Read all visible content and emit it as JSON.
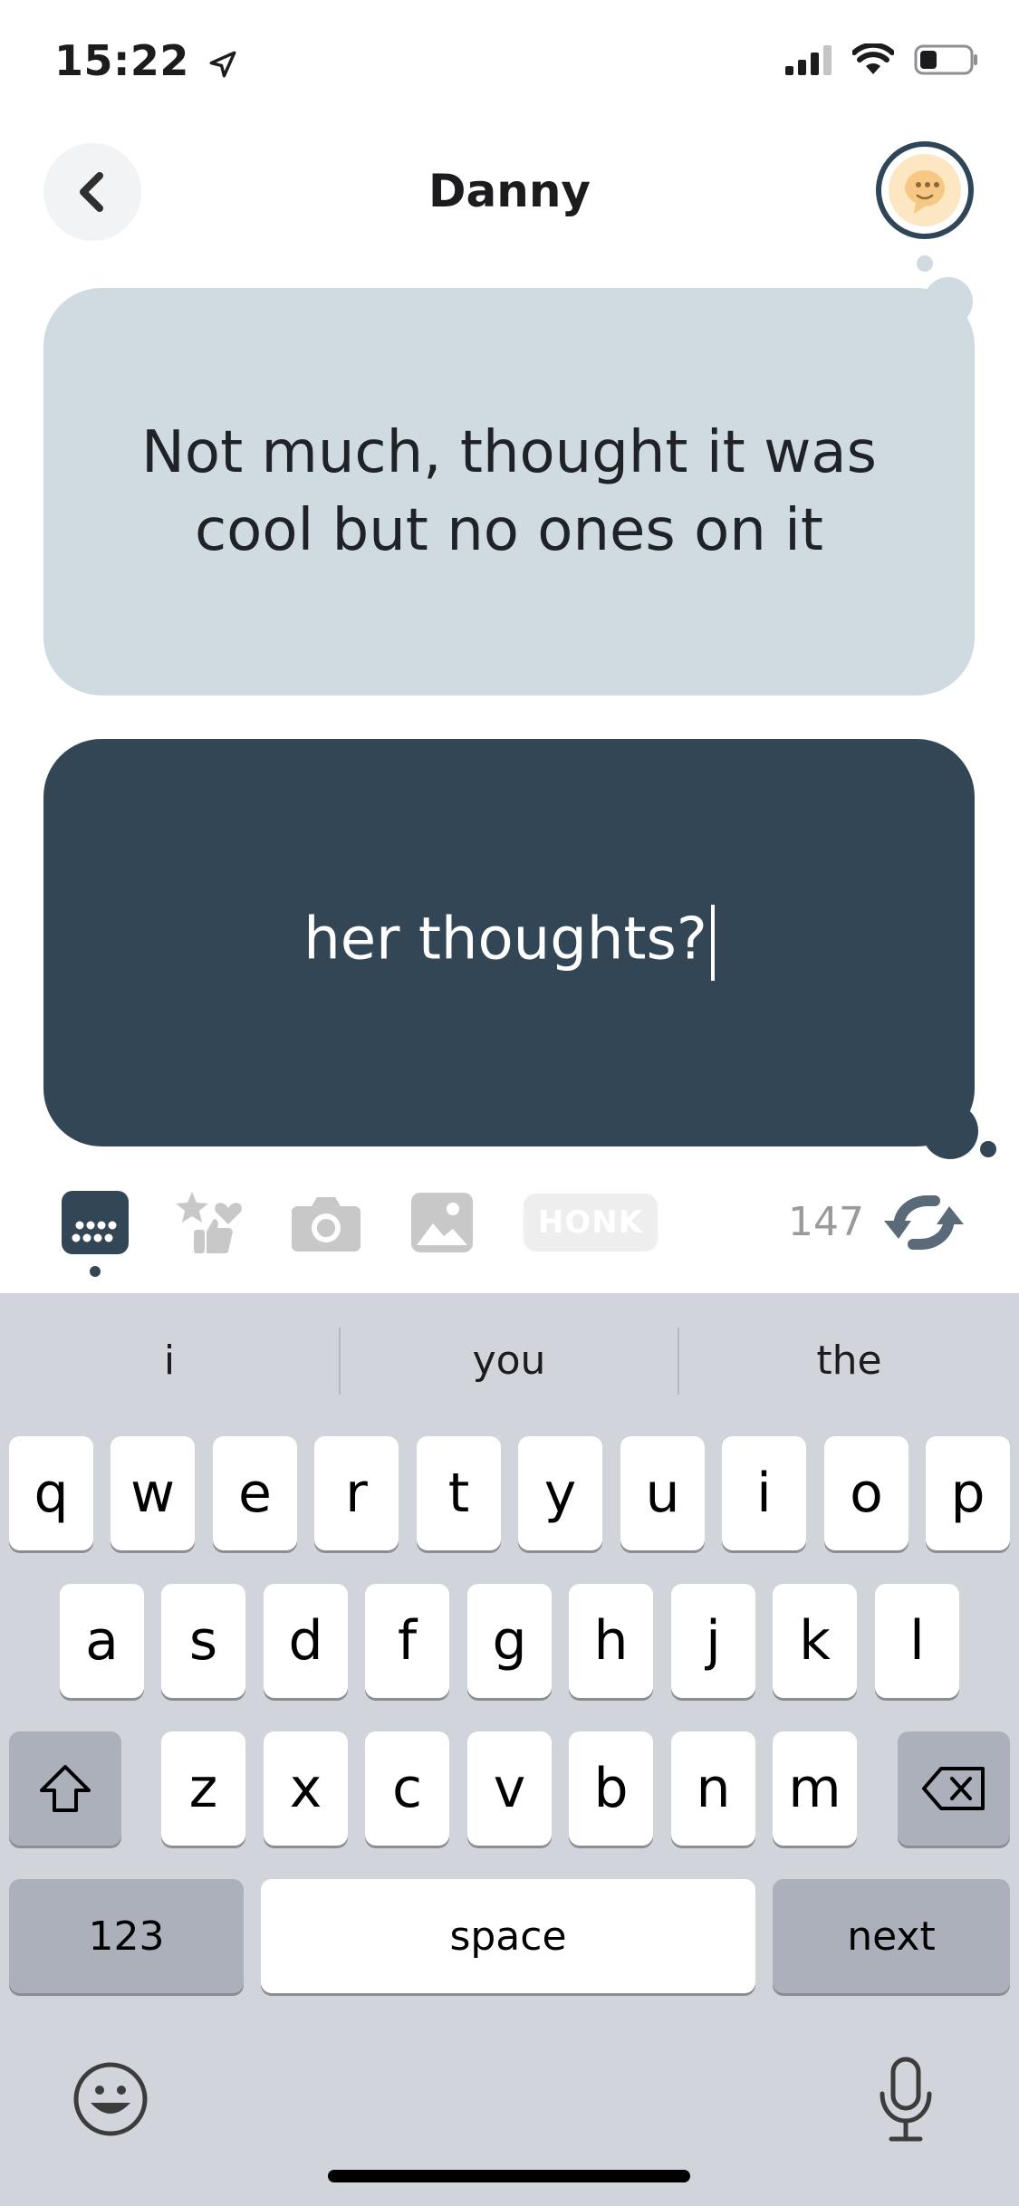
{
  "status_bar": {
    "time": "15:22"
  },
  "header": {
    "title": "Danny"
  },
  "messages": [
    {
      "text": "Not much, thought it was cool but no ones on it"
    },
    {
      "text": "her thoughts?"
    }
  ],
  "toolbar": {
    "honk_label": "HONK",
    "char_count": "147"
  },
  "keyboard": {
    "suggestions": [
      "i",
      "you",
      "the"
    ],
    "row1": [
      "q",
      "w",
      "e",
      "r",
      "t",
      "y",
      "u",
      "i",
      "o",
      "p"
    ],
    "row2": [
      "a",
      "s",
      "d",
      "f",
      "g",
      "h",
      "j",
      "k",
      "l"
    ],
    "row3": [
      "z",
      "x",
      "c",
      "v",
      "b",
      "n",
      "m"
    ],
    "numbers_label": "123",
    "space_label": "space",
    "next_label": "next"
  },
  "colors": {
    "incoming_bubble": "#d0dbe1",
    "outgoing_bubble": "#324656",
    "keyboard_bg": "#d1d5db"
  },
  "icons": [
    "location-arrow-icon",
    "signal-icon",
    "wifi-icon",
    "battery-icon",
    "back-chevron-icon",
    "chat-avatar-icon",
    "keyboard-icon",
    "stickers-icon",
    "camera-icon",
    "photo-icon",
    "refresh-icon",
    "shift-icon",
    "backspace-icon",
    "emoji-icon",
    "microphone-icon"
  ]
}
